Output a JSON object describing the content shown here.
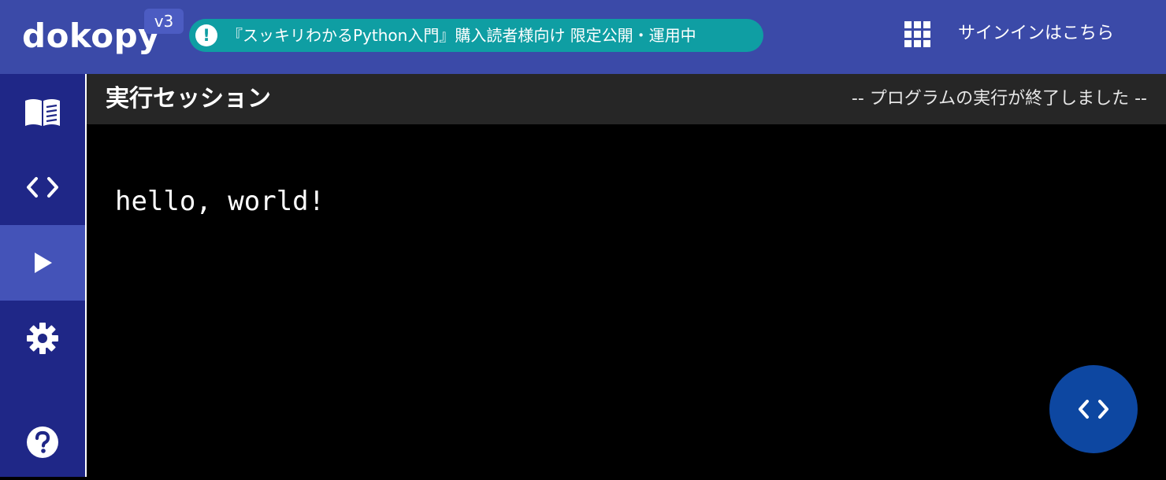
{
  "header": {
    "brand": "dokopy",
    "version": "v3",
    "notice_icon": "!",
    "notice_text": "『スッキリわかるPython入門』購入読者様向け 限定公開・運用中",
    "apps_icon": "apps-grid-icon",
    "signin_label": "サインインはこちら"
  },
  "sidebar": {
    "items": [
      {
        "icon": "book-icon",
        "active": false
      },
      {
        "icon": "code-icon",
        "active": false
      },
      {
        "icon": "play-icon",
        "active": true
      },
      {
        "icon": "gear-icon",
        "active": false
      },
      {
        "icon": "help-icon",
        "active": false
      }
    ]
  },
  "session": {
    "title": "実行セッション",
    "status": "-- プログラムの実行が終了しました --",
    "output": "hello, world!"
  },
  "fab": {
    "icon": "code-icon"
  },
  "colors": {
    "header_bg": "#3b4aa8",
    "sidebar_bg": "#1f2787",
    "sidebar_active": "#4453b8",
    "notice_bg": "#0f9ea3",
    "titlebar_bg": "#262626",
    "fab_bg": "#0d47a1"
  }
}
